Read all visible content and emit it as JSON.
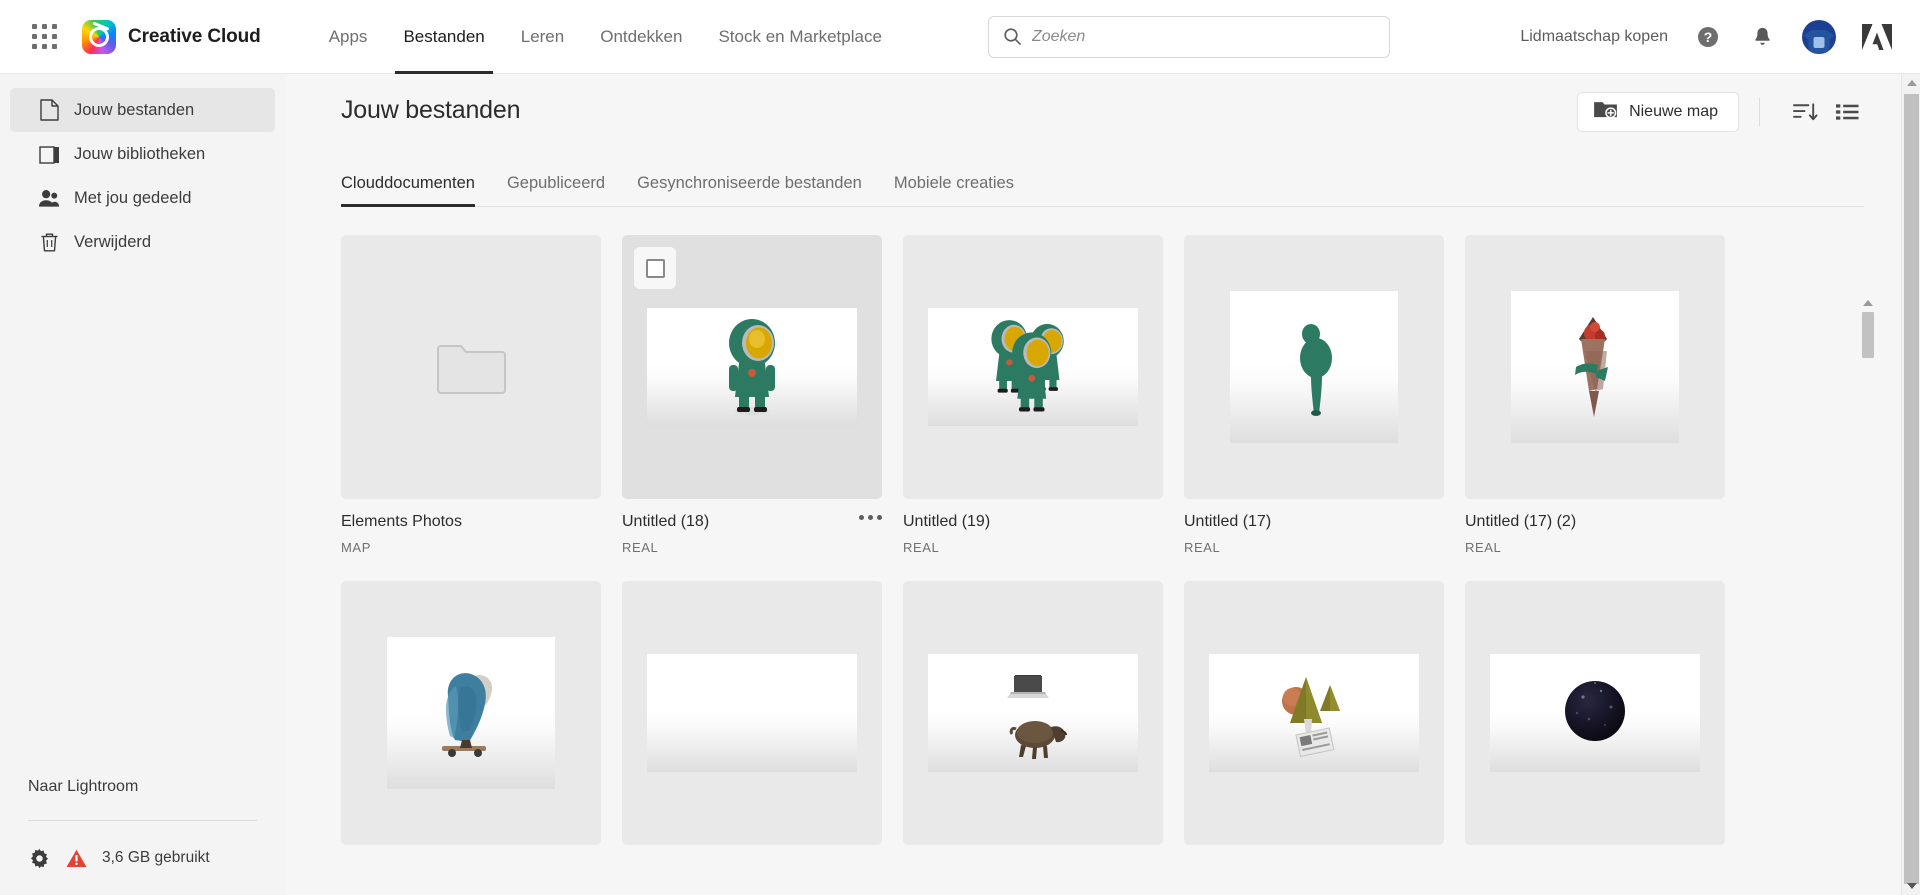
{
  "header": {
    "app_grid_icon": "app-grid-icon",
    "brand_icon": "creative-cloud-logo-icon",
    "brand_name": "Creative Cloud",
    "nav": [
      {
        "label": "Apps",
        "active": false
      },
      {
        "label": "Bestanden",
        "active": true
      },
      {
        "label": "Leren",
        "active": false
      },
      {
        "label": "Ontdekken",
        "active": false
      },
      {
        "label": "Stock en Marketplace",
        "active": false
      }
    ],
    "search": {
      "value": "",
      "placeholder": "Zoeken",
      "icon": "search-icon"
    },
    "buy_membership": "Lidmaatschap kopen",
    "help_icon": "help-circle-icon",
    "notifications_icon": "bell-icon",
    "avatar_icon": "user-avatar",
    "adobe_logo_icon": "adobe-logo-icon"
  },
  "sidebar": {
    "items": [
      {
        "label": "Jouw bestanden",
        "icon": "file-icon",
        "active": true
      },
      {
        "label": "Jouw bibliotheken",
        "icon": "library-icon",
        "active": false
      },
      {
        "label": "Met jou gedeeld",
        "icon": "people-icon",
        "active": false
      },
      {
        "label": "Verwijderd",
        "icon": "trash-icon",
        "active": false
      }
    ],
    "lightroom_link": "Naar Lightroom",
    "settings_icon": "gear-icon",
    "warning_icon": "warning-triangle-icon",
    "storage_used": "3,6 GB gebruikt"
  },
  "main": {
    "page_title": "Jouw bestanden",
    "new_folder_button": "Nieuwe map",
    "new_folder_icon": "new-folder-icon",
    "sort_icon": "sort-descending-icon",
    "list_view_icon": "list-view-icon",
    "tabs": [
      {
        "label": "Clouddocumenten",
        "active": true
      },
      {
        "label": "Gepubliceerd",
        "active": false
      },
      {
        "label": "Gesynchroniseerde bestanden",
        "active": false
      },
      {
        "label": "Mobiele creaties",
        "active": false
      }
    ],
    "cards": [
      {
        "name": "Elements Photos",
        "type": "MAP",
        "kind": "folder",
        "selected": false,
        "hovered": false,
        "has_menu": false
      },
      {
        "name": "Untitled (18)",
        "type": "REAL",
        "kind": "thumb",
        "thumb": "green-astronaut-figure",
        "selected": true,
        "hovered": true,
        "has_menu": true
      },
      {
        "name": "Untitled (19)",
        "type": "REAL",
        "kind": "thumb",
        "thumb": "three-green-astronaut-figures",
        "selected": false,
        "hovered": false,
        "has_menu": false
      },
      {
        "name": "Untitled (17)",
        "type": "REAL",
        "kind": "thumb",
        "thumb": "green-blob-figure",
        "selected": false,
        "hovered": false,
        "has_menu": false
      },
      {
        "name": "Untitled (17) (2)",
        "type": "REAL",
        "kind": "thumb",
        "thumb": "flower-bouquet",
        "selected": false,
        "hovered": false,
        "has_menu": false
      },
      {
        "name": "",
        "type": "",
        "kind": "thumb",
        "thumb": "blue-cloud-rock-on-board",
        "selected": false,
        "hovered": false,
        "has_menu": false
      },
      {
        "name": "",
        "type": "",
        "kind": "thumb",
        "thumb": "empty-scene",
        "selected": false,
        "hovered": false,
        "has_menu": false
      },
      {
        "name": "",
        "type": "",
        "kind": "thumb",
        "thumb": "laptop-and-boar",
        "selected": false,
        "hovered": false,
        "has_menu": false
      },
      {
        "name": "",
        "type": "",
        "kind": "thumb",
        "thumb": "cones-sphere-and-newspaper",
        "selected": false,
        "hovered": false,
        "has_menu": false
      },
      {
        "name": "",
        "type": "",
        "kind": "thumb",
        "thumb": "dark-planet-sphere",
        "selected": false,
        "hovered": false,
        "has_menu": false
      }
    ]
  },
  "scrollbars": {
    "inner": {
      "name": "content-scrollbar"
    },
    "outer": {
      "name": "browser-scrollbar"
    }
  },
  "colors": {
    "sidebar_bg": "#f4f4f4",
    "main_bg": "#f6f6f6",
    "card_bg": "#e9e9e9",
    "accent_text": "#2c2c2c",
    "muted_text": "#6e6e6e",
    "warning_red": "#e34234"
  }
}
